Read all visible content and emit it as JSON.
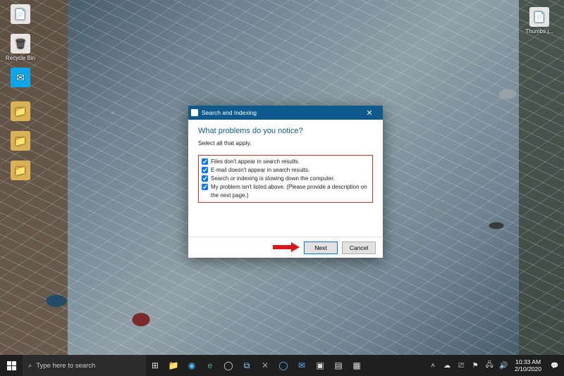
{
  "desktop_icons": [
    {
      "label": "Recycle Bin",
      "glyph": "🗑"
    },
    {
      "label": "",
      "glyph": "📨"
    },
    {
      "label": "",
      "glyph": "📁"
    },
    {
      "label": "",
      "glyph": "📁"
    },
    {
      "label": "",
      "glyph": "📁"
    },
    {
      "label": "Thumbs.j...",
      "glyph": "📄"
    }
  ],
  "dialog": {
    "title": "Search and Indexing",
    "heading": "What problems do you notice?",
    "subheading": "Select all that apply.",
    "options": [
      "Files don't appear in search results.",
      "E-mail doesn't appear in search results.",
      "Search or indexing is slowing down the computer.",
      "My problem isn't listed above. (Please provide a description on the next page.)"
    ],
    "next": "Next",
    "cancel": "Cancel"
  },
  "taskbar": {
    "search_placeholder": "Type here to search",
    "time": "10:33 AM",
    "date": "2/10/2020"
  }
}
